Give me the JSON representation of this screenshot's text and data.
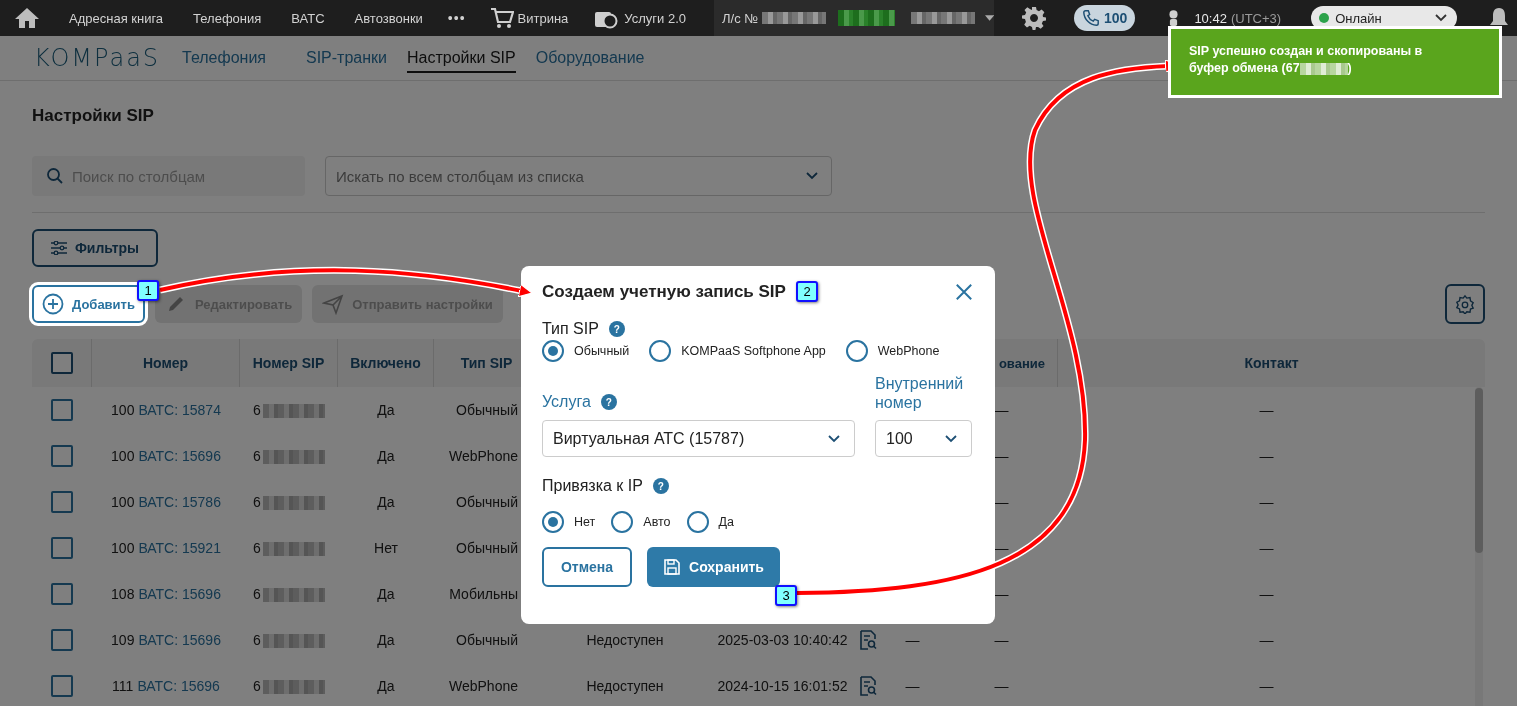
{
  "top_bar": {
    "nav": [
      {
        "label": "Адресная книга"
      },
      {
        "label": "Телефония"
      },
      {
        "label": "ВАТС"
      },
      {
        "label": "Автозвонки"
      }
    ],
    "more": "•••",
    "shop": "Витрина",
    "services": "Услуги 2.0",
    "account": "Л/с №",
    "calls": "100",
    "time": "10:42",
    "timezone": "(UTC+3)",
    "status": {
      "label": "Онлайн",
      "color": "#2ca24a"
    }
  },
  "logo": "KOMPaaS",
  "sub_nav": [
    {
      "label": "Телефония",
      "selected": false
    },
    {
      "label": "SIP-транки",
      "selected": false
    },
    {
      "label": "Настройки SIP",
      "selected": true
    },
    {
      "label": "Оборудование",
      "selected": false
    }
  ],
  "page": {
    "title": "Настройки SIP",
    "search": {
      "placeholder": "Поиск по столбцам"
    },
    "scope_select": {
      "placeholder": "Искать по всем столбцам из списка"
    },
    "filters_button": "Фильтры",
    "actions": [
      {
        "kind": "add",
        "label": "Добавить",
        "disabled": false
      },
      {
        "kind": "edit",
        "label": "Редактировать",
        "disabled": true
      },
      {
        "kind": "send",
        "label": "Отправить настройки",
        "disabled": true
      }
    ]
  },
  "table": {
    "all_checked": false,
    "headers": [
      "Номер",
      "Номер SIP",
      "Включено",
      "Тип SIP",
      "ование",
      "Контакт"
    ],
    "rows": [
      {
        "checked": false,
        "number": "100",
        "service": "ВАТС: 15874",
        "sip_number": "6",
        "enabled": "Да",
        "sip_type": "Обычный",
        "column_10": "—",
        "contact": "—"
      },
      {
        "checked": false,
        "number": "100",
        "service": "ВАТС: 15696",
        "sip_number": "6",
        "enabled": "Да",
        "sip_type": "WebPhone",
        "column_10": "—",
        "contact": "—"
      },
      {
        "checked": false,
        "number": "100",
        "service": "ВАТС: 15786",
        "sip_number": "6",
        "enabled": "Да",
        "sip_type": "Обычный",
        "column_10": "—",
        "contact": "—"
      },
      {
        "checked": false,
        "number": "100",
        "service": "ВАТС: 15921",
        "sip_number": "6",
        "enabled": "Нет",
        "sip_type": "Обычный",
        "column_10": "—",
        "contact": "—"
      },
      {
        "checked": false,
        "number": "108",
        "service": "ВАТС: 15696",
        "sip_number": "6",
        "enabled": "Да",
        "sip_type": "Мобильны",
        "column_10": "—",
        "contact": "—"
      },
      {
        "checked": false,
        "number": "109",
        "service": "ВАТС: 15696",
        "sip_number": "6",
        "enabled": "Да",
        "sip_type": "Обычный",
        "column_6": "Недоступен",
        "column_7": "2025-03-03 10:40:42",
        "column_9": "—",
        "column_10": "—",
        "contact": "—"
      },
      {
        "checked": false,
        "number": "111",
        "service": "ВАТС: 15696",
        "sip_number": "6",
        "enabled": "Да",
        "sip_type": "WebPhone",
        "column_6": "Недоступен",
        "column_7": "2024-10-15 16:01:52",
        "column_9": "—",
        "column_10": "—",
        "contact": "—"
      }
    ]
  },
  "dialog": {
    "title": "Создаем учетную запись SIP",
    "sip_type": {
      "label": "Тип SIP",
      "help": "?",
      "options": [
        {
          "label": "Обычный",
          "selected": true
        },
        {
          "label": "KOMPaaS Softphone App",
          "selected": false
        },
        {
          "label": "WebPhone",
          "selected": false
        }
      ]
    },
    "service": {
      "label": "Услуга",
      "help": "?",
      "value": "Виртуальная АТС (15787)"
    },
    "extension": {
      "label": "Внутренний номер",
      "value": "100"
    },
    "ip_binding": {
      "label": "Привязка к IP",
      "help": "?",
      "options": [
        {
          "label": "Нет",
          "selected": true
        },
        {
          "label": "Авто",
          "selected": false
        },
        {
          "label": "Да",
          "selected": false
        }
      ]
    },
    "cancel": "Отмена",
    "save": "Сохранить"
  },
  "toast": {
    "message_start": "SIP успешно создан и скопированы в буфер обмена (67",
    "message_end": ")"
  },
  "callouts": [
    "1",
    "2",
    "3"
  ]
}
